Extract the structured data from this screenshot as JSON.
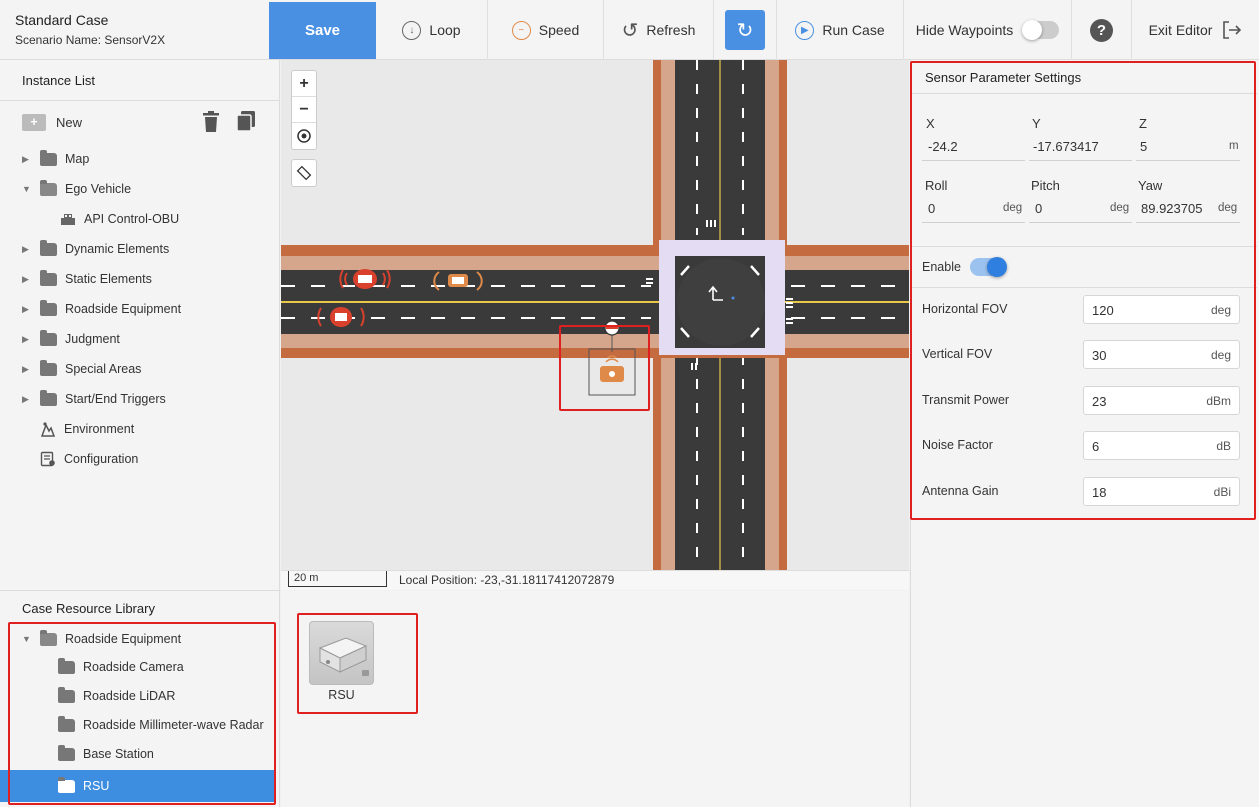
{
  "header": {
    "title": "Standard Case",
    "scenario": "Scenario Name: SensorV2X"
  },
  "toolbar": {
    "save": "Save",
    "loop": "Loop",
    "speed": "Speed",
    "refresh": "Refresh",
    "run_case": "Run Case",
    "hide_waypoints": "Hide Waypoints",
    "hide_waypoints_on": false,
    "exit_editor": "Exit Editor",
    "accent": "#4a90e2"
  },
  "instance_list": {
    "heading": "Instance List",
    "new_label": "New",
    "items": [
      {
        "label": "Map",
        "icon": "folder-icon"
      },
      {
        "label": "Ego Vehicle",
        "icon": "folder-open-icon"
      },
      {
        "label": "API Control-OBU",
        "icon": "vehicle-icon"
      },
      {
        "label": "Dynamic Elements",
        "icon": "folder-icon"
      },
      {
        "label": "Static Elements",
        "icon": "folder-icon"
      },
      {
        "label": "Roadside Equipment",
        "icon": "folder-icon"
      },
      {
        "label": "Judgment",
        "icon": "folder-icon"
      },
      {
        "label": "Special Areas",
        "icon": "folder-icon"
      },
      {
        "label": "Start/End Triggers",
        "icon": "folder-icon"
      },
      {
        "label": "Environment",
        "icon": "environment-icon"
      },
      {
        "label": "Configuration",
        "icon": "configuration-icon"
      }
    ]
  },
  "resource_library": {
    "heading": "Case Resource Library",
    "items": [
      {
        "label": "Roadside Equipment"
      },
      {
        "label": "Roadside Camera"
      },
      {
        "label": "Roadside LiDAR"
      },
      {
        "label": "Roadside Millimeter-wave Radar"
      },
      {
        "label": "Base Station"
      },
      {
        "label": "RSU",
        "selected": true
      }
    ],
    "selected_color": "#3d8ee0",
    "card_label": "RSU"
  },
  "map": {
    "scale": "20 m",
    "local_position": "Local Position: -23,-31.18117412072879"
  },
  "sensor": {
    "title": "Sensor Parameter Settings",
    "x_label": "X",
    "x": "-24.2",
    "y_label": "Y",
    "y": "-17.673417",
    "z_label": "Z",
    "z": "5",
    "z_unit": "m",
    "roll_label": "Roll",
    "roll": "0",
    "roll_unit": "deg",
    "pitch_label": "Pitch",
    "pitch": "0",
    "pitch_unit": "deg",
    "yaw_label": "Yaw",
    "yaw": "89.923705",
    "yaw_unit": "deg",
    "enable_label": "Enable",
    "enable_on": true,
    "fields": [
      {
        "label": "Horizontal FOV",
        "value": "120",
        "unit": "deg"
      },
      {
        "label": "Vertical FOV",
        "value": "30",
        "unit": "deg"
      },
      {
        "label": "Transmit Power",
        "value": "23",
        "unit": "dBm"
      },
      {
        "label": "Noise Factor",
        "value": "6",
        "unit": "dB"
      },
      {
        "label": "Antenna Gain",
        "value": "18",
        "unit": "dBi"
      }
    ]
  }
}
